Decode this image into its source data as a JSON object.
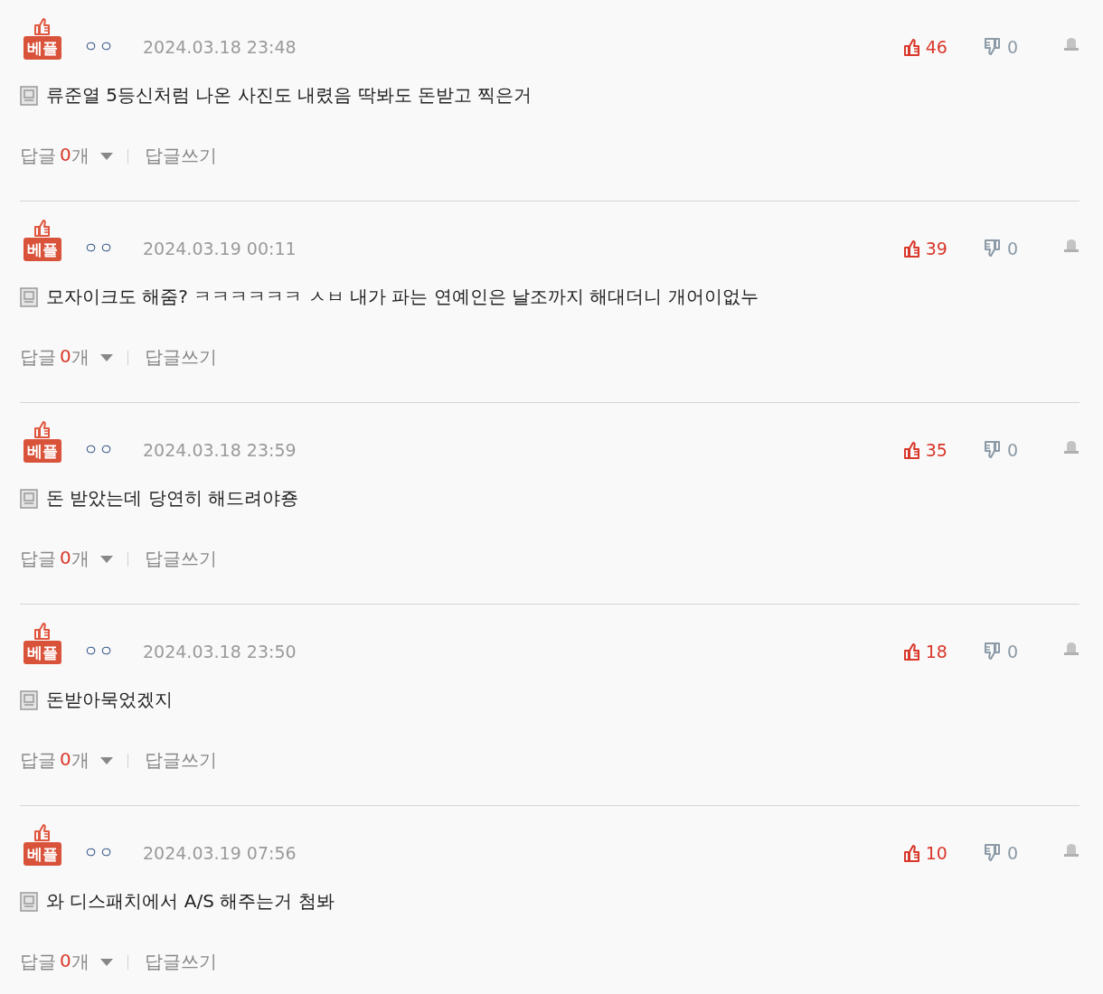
{
  "comments": [
    {
      "badge": "베플",
      "user": "ㅇㅇ",
      "date": "2024.03.18 23:48",
      "likes": "46",
      "dislikes": "0",
      "text": "류준열 5등신처럼 나온 사진도 내렸음 딱봐도 돈받고 찍은거",
      "reply_label": "답글",
      "reply_count": "0",
      "reply_unit": "개",
      "write_reply": "답글쓰기"
    },
    {
      "badge": "베플",
      "user": "ㅇㅇ",
      "date": "2024.03.19 00:11",
      "likes": "39",
      "dislikes": "0",
      "text": "모자이크도 해줌? ㅋㅋㅋㅋㅋㅋ ㅅㅂ 내가 파는 연예인은 날조까지 해대더니 개어이없누",
      "reply_label": "답글",
      "reply_count": "0",
      "reply_unit": "개",
      "write_reply": "답글쓰기"
    },
    {
      "badge": "베플",
      "user": "ㅇㅇ",
      "date": "2024.03.18 23:59",
      "likes": "35",
      "dislikes": "0",
      "text": "돈 받았는데 당연히 해드려야죵",
      "reply_label": "답글",
      "reply_count": "0",
      "reply_unit": "개",
      "write_reply": "답글쓰기"
    },
    {
      "badge": "베플",
      "user": "ㅇㅇ",
      "date": "2024.03.18 23:50",
      "likes": "18",
      "dislikes": "0",
      "text": "돈받아묵었겠지",
      "reply_label": "답글",
      "reply_count": "0",
      "reply_unit": "개",
      "write_reply": "답글쓰기"
    },
    {
      "badge": "베플",
      "user": "ㅇㅇ",
      "date": "2024.03.19 07:56",
      "likes": "10",
      "dislikes": "0",
      "text": "와 디스패치에서 A/S 해주는거 첨봐",
      "reply_label": "답글",
      "reply_count": "0",
      "reply_unit": "개",
      "write_reply": "답글쓰기"
    }
  ]
}
